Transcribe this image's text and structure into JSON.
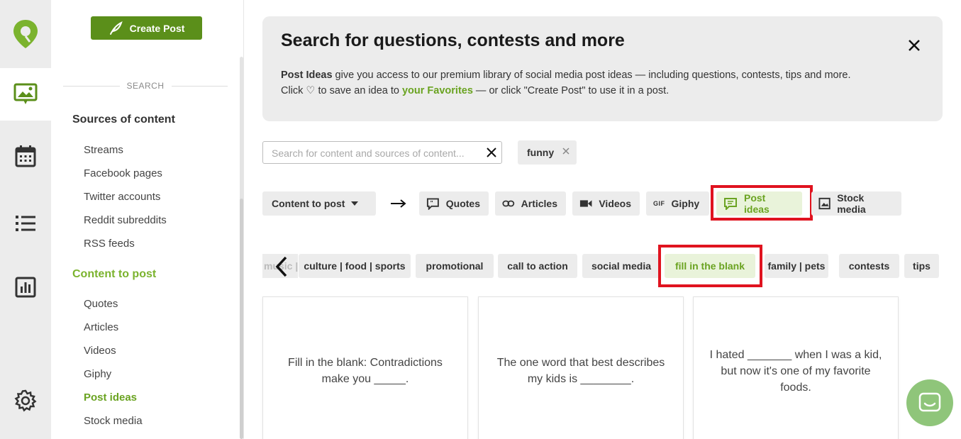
{
  "sidebar": {
    "create_label": "Create Post",
    "search_label": "SEARCH",
    "sources_title": "Sources of content",
    "sources": [
      "Streams",
      "Facebook pages",
      "Twitter accounts",
      "Reddit subreddits",
      "RSS feeds"
    ],
    "content_title": "Content to post",
    "content_items": [
      "Quotes",
      "Articles",
      "Videos",
      "Giphy",
      "Post ideas",
      "Stock media"
    ],
    "active_item": "Post ideas"
  },
  "banner": {
    "title": "Search for questions, contests and more",
    "line1_strong": "Post Ideas",
    "line1_rest": " give you access to our premium library of social media post ideas — including questions, contests, tips and more.",
    "line2_a": "Click ♡ to save an idea to ",
    "line2_link": "your Favorites",
    "line2_b": " — or click \"Create Post\" to use it in a post."
  },
  "search": {
    "placeholder": "Search for content and sources of content...",
    "tag": "funny"
  },
  "filters": {
    "dropdown_label": "Content to post",
    "types": [
      "Quotes",
      "Articles",
      "Videos",
      "Giphy",
      "Post ideas",
      "Stock media"
    ],
    "gif_badge": "GIF",
    "selected_type": "Post ideas"
  },
  "categories": {
    "partial": "music |",
    "items": [
      "culture | food | sports",
      "promotional",
      "call to action",
      "social media",
      "fill in the blank",
      "family | pets",
      "contests",
      "tips"
    ],
    "selected": "fill in the blank"
  },
  "cards": [
    "Fill in the blank: Contradictions make you _____.",
    "The one word that best describes my kids is ________.",
    "I hated _______ when I was a kid, but now it's one of my favorite foods."
  ],
  "colors": {
    "brand_green": "#6aa321",
    "button_green": "#5b8f1a",
    "highlight_red": "#e0131f",
    "chat_green": "#8fc57a"
  }
}
